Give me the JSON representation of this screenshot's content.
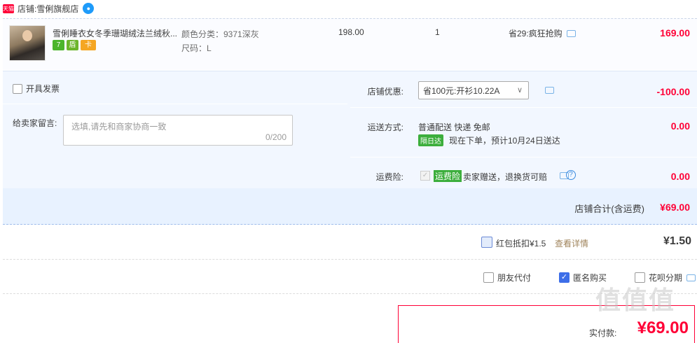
{
  "shop": {
    "badge": "天猫",
    "label": "店铺:",
    "name": "雪俐旗舰店",
    "chat_icon": "chat-bubble-icon"
  },
  "item": {
    "title": "雪俐睡衣女冬季珊瑚绒法兰绒秋...",
    "sku_color": "颜色分类：9371深灰",
    "sku_size": "尺码：L",
    "price": "198.00",
    "quantity": "1",
    "promo": "省29:疯狂抢购",
    "total": "169.00",
    "service_icons": [
      "7",
      "盾",
      "卡"
    ]
  },
  "invoice": {
    "label": "开具发票"
  },
  "memo": {
    "label": "给卖家留言:",
    "placeholder": "选填,请先和商家协商一致",
    "count": "0/200"
  },
  "coupon": {
    "label": "店铺优惠:",
    "selected": "省100元:开衫10.22A",
    "amount": "-100.00"
  },
  "shipping": {
    "label": "运送方式:",
    "method": "普通配送 快递 免邮",
    "badge": "隔日达",
    "eta": "现在下单，预计10月24日送达",
    "amount": "0.00"
  },
  "insurance": {
    "label": "运费险:",
    "tag": "运费险",
    "text": "卖家赠送，退换货可赔",
    "amount": "0.00"
  },
  "shop_total": {
    "label": "店铺合计(含运费)",
    "amount": "¥69.00"
  },
  "redpack": {
    "label": "红包抵扣¥1.5",
    "link": "查看详情",
    "amount": "¥1.50"
  },
  "options": {
    "friend_pay": "朋友代付",
    "anonymous": "匿名购买",
    "huabei": "花呗分期"
  },
  "payment": {
    "label": "实付款:",
    "amount": "¥69.00"
  },
  "watermark": "值值值",
  "colors": {
    "accent_red": "#ff0036",
    "tmall_red": "#ff0036",
    "panel_blue": "#f2f7ff",
    "link_brown": "#a0845c",
    "green_tag": "#3cae3c"
  }
}
